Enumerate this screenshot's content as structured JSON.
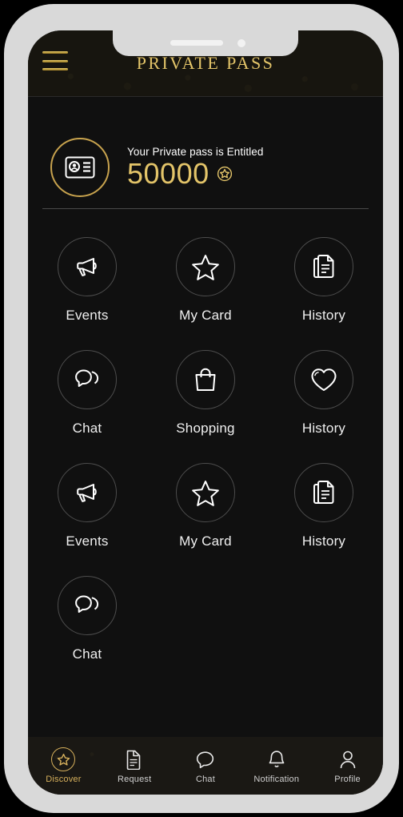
{
  "device": {
    "frame_color": "#d9d9d9",
    "screen_bg": "#101010",
    "notch": {
      "speaker_icon": "speaker-slot",
      "camera_icon": "front-camera-dot"
    }
  },
  "theme": {
    "gold": "#e3c469",
    "gold_dark": "#9c7b22",
    "gold_muted": "#c8a34e",
    "text_primary": "#ffffff",
    "text_secondary": "#cfcfcf",
    "ring_border": "#4d4d4d",
    "divider": "#4a4a4a",
    "header_bg": "#17150f",
    "nav_bg": "#1a1814"
  },
  "header": {
    "menu_icon": "hamburger-menu-icon",
    "title": "PRIVATE PASS"
  },
  "balance": {
    "icon": "id-card-icon",
    "caption": "Your Private pass is Entitled",
    "amount": "50000",
    "badge_icon": "star-badge-icon"
  },
  "menu_grid": {
    "items": [
      {
        "label": "Events",
        "icon": "megaphone-icon"
      },
      {
        "label": "My Card",
        "icon": "star-icon"
      },
      {
        "label": "History",
        "icon": "documents-icon"
      },
      {
        "label": "Chat",
        "icon": "chat-bubbles-icon"
      },
      {
        "label": "Shopping",
        "icon": "shopping-bag-icon"
      },
      {
        "label": "History",
        "icon": "heart-icon"
      },
      {
        "label": "Events",
        "icon": "megaphone-icon"
      },
      {
        "label": "My Card",
        "icon": "star-icon"
      },
      {
        "label": "History",
        "icon": "documents-icon"
      },
      {
        "label": "Chat",
        "icon": "chat-bubbles-icon"
      }
    ]
  },
  "bottom_nav": {
    "items": [
      {
        "label": "Discover",
        "icon": "star-circle-icon",
        "active": true
      },
      {
        "label": "Request",
        "icon": "document-icon",
        "active": false
      },
      {
        "label": "Chat",
        "icon": "chat-bubble-icon",
        "active": false
      },
      {
        "label": "Notification",
        "icon": "bell-icon",
        "active": false
      },
      {
        "label": "Profile",
        "icon": "person-icon",
        "active": false
      }
    ]
  }
}
